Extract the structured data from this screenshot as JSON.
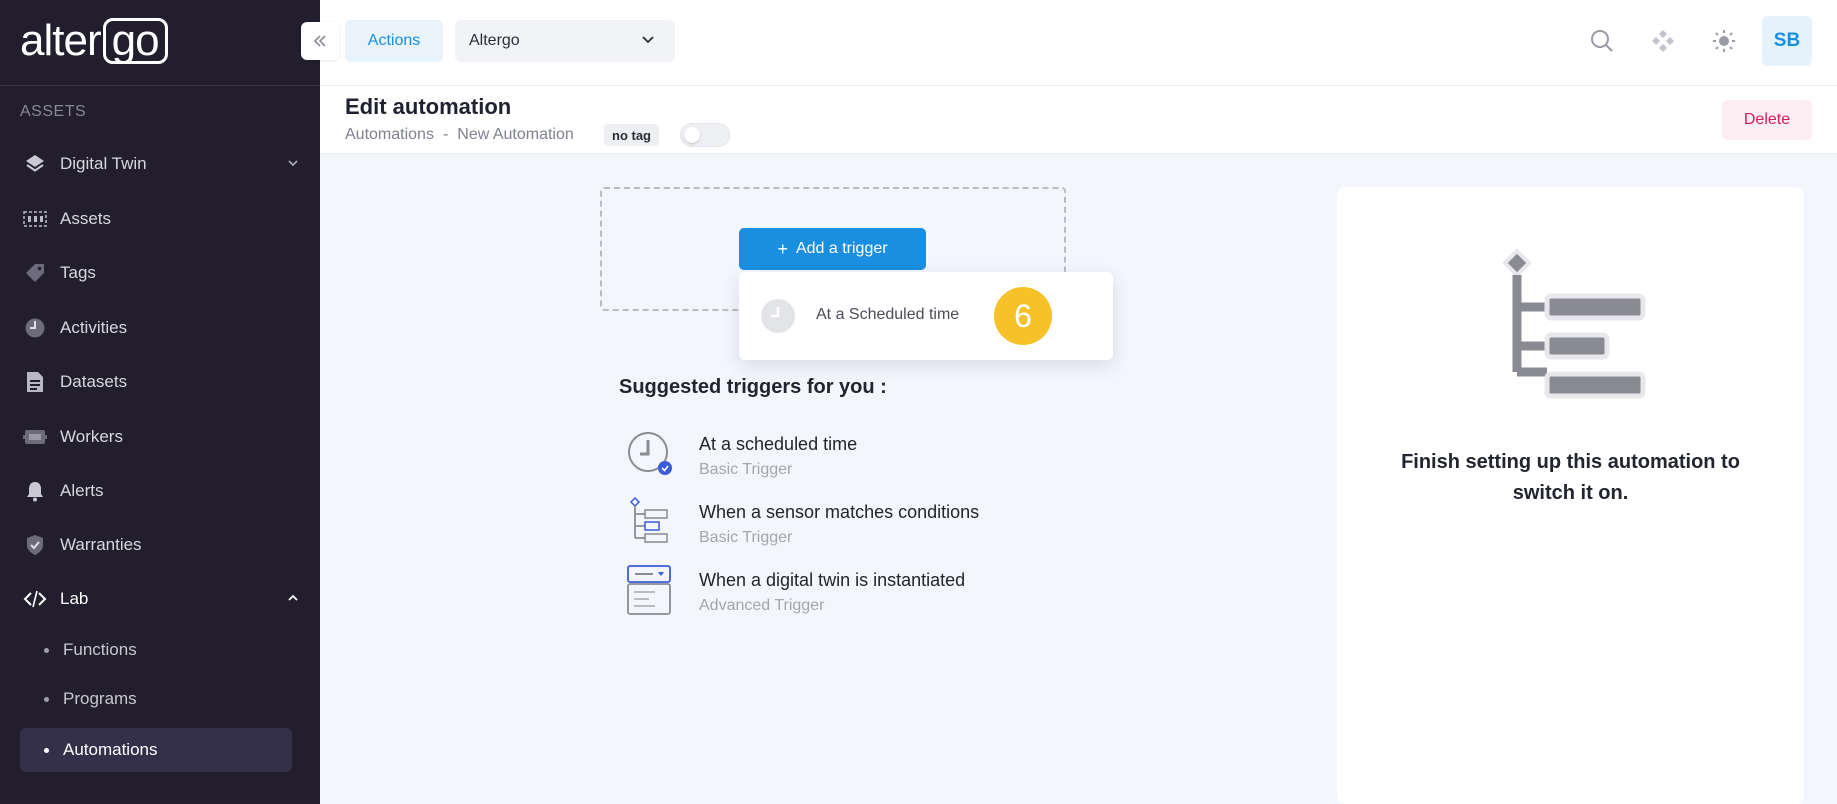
{
  "sidebar": {
    "logo": {
      "part1": "alter",
      "part2": "go"
    },
    "section_label": "ASSETS",
    "items": [
      {
        "label": "Digital Twin",
        "icon": "layers-icon"
      },
      {
        "label": "Assets",
        "icon": "assets-icon"
      },
      {
        "label": "Tags",
        "icon": "tag-icon"
      },
      {
        "label": "Activities",
        "icon": "activity-icon"
      },
      {
        "label": "Datasets",
        "icon": "dataset-icon"
      },
      {
        "label": "Workers",
        "icon": "worker-icon"
      },
      {
        "label": "Alerts",
        "icon": "bell-icon"
      },
      {
        "label": "Warranties",
        "icon": "shield-icon"
      },
      {
        "label": "Lab",
        "icon": "code-icon"
      }
    ],
    "lab_sub_items": [
      {
        "label": "Functions"
      },
      {
        "label": "Programs"
      },
      {
        "label": "Automations",
        "active": true
      }
    ]
  },
  "topbar": {
    "actions_label": "Actions",
    "org_select_value": "Altergo",
    "avatar_initials": "SB"
  },
  "page": {
    "title": "Edit automation",
    "breadcrumb": [
      "Automations",
      "-",
      "New Automation"
    ],
    "tag": "no tag",
    "switch_on": false,
    "delete_label": "Delete"
  },
  "trigger": {
    "add_label": "Add a trigger",
    "dropdown_option": "At a Scheduled time",
    "step_badge": "6"
  },
  "suggestions": {
    "title": "Suggested triggers for you :",
    "items": [
      {
        "title": "At a scheduled time",
        "subtitle": "Basic Trigger",
        "icon": "clock-icon"
      },
      {
        "title": "When a sensor matches conditions",
        "subtitle": "Basic Trigger",
        "icon": "tree-icon"
      },
      {
        "title": "When a digital twin is instantiated",
        "subtitle": "Advanced Trigger",
        "icon": "window-icon"
      }
    ]
  },
  "right_panel": {
    "message": "Finish setting up this automation to switch it on."
  },
  "colors": {
    "accent": "#1a8fe0",
    "sidebar_bg": "#221e2e",
    "badge": "#f6c228",
    "delete": "#d81b60"
  }
}
